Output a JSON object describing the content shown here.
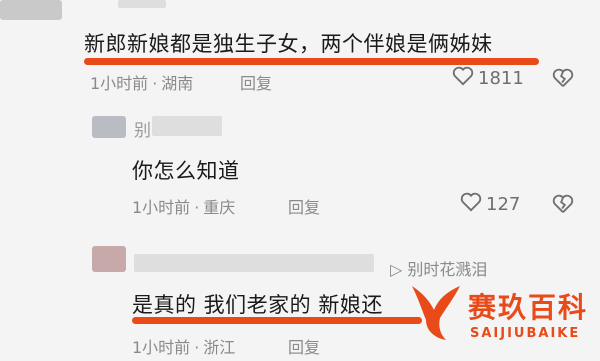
{
  "comments": [
    {
      "text": "新郎新娘都是独生子女，两个伴娘是俩姊妹",
      "time": "1小时前",
      "location": "湖南",
      "reply_label": "回复",
      "likes": "1811"
    },
    {
      "name": "别",
      "text": "你怎么知道",
      "time": "1小时前",
      "location": "重庆",
      "reply_label": "回复",
      "likes": "127"
    },
    {
      "reply_to_arrow": "▷",
      "reply_to_name": "别时花溅泪",
      "text": "是真的 我们老家的 新娘还",
      "time": "1小时前",
      "location": "浙江",
      "reply_label": "回复"
    }
  ],
  "watermark": {
    "brand": "赛玖百科",
    "brand_en": "SAIJIUBAIKE",
    "color": "#e84a1a"
  },
  "colors": {
    "highlight": "#e84a1a",
    "meta": "#8a8a8a"
  },
  "icons": [
    "heart-icon",
    "broken-heart-icon",
    "play-triangle-icon",
    "fish-tail-logo"
  ]
}
